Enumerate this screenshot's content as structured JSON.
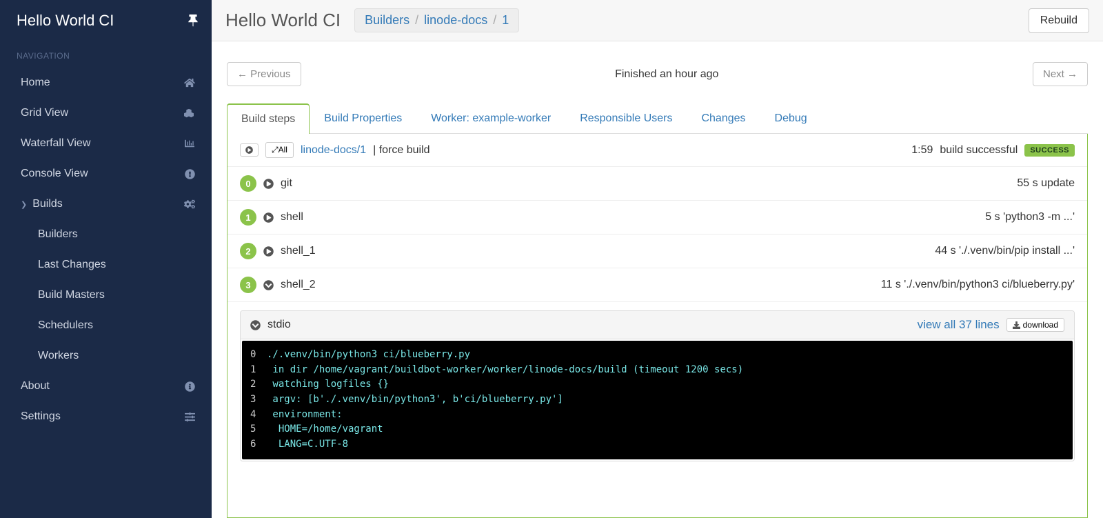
{
  "sidebar": {
    "title": "Hello World CI",
    "nav_label": "NAVIGATION",
    "items": [
      {
        "label": "Home"
      },
      {
        "label": "Grid View"
      },
      {
        "label": "Waterfall View"
      },
      {
        "label": "Console View"
      },
      {
        "label": "Builds"
      },
      {
        "label": "About"
      },
      {
        "label": "Settings"
      }
    ],
    "builds_sub": [
      {
        "label": "Builders"
      },
      {
        "label": "Last Changes"
      },
      {
        "label": "Build Masters"
      },
      {
        "label": "Schedulers"
      },
      {
        "label": "Workers"
      }
    ]
  },
  "header": {
    "title": "Hello World CI",
    "crumbs": [
      "Builders",
      "linode-docs",
      "1"
    ],
    "rebuild": "Rebuild"
  },
  "nav": {
    "prev": "← Previous",
    "next": "Next →",
    "finished": "Finished an hour ago"
  },
  "tabs": [
    "Build steps",
    "Build Properties",
    "Worker: example-worker",
    "Responsible Users",
    "Changes",
    "Debug"
  ],
  "summary": {
    "expand_all": "All",
    "link": "linode-docs/1",
    "desc": "| force build",
    "time": "1:59",
    "status_text": "build successful",
    "badge": "SUCCESS"
  },
  "steps": [
    {
      "n": "0",
      "name": "git",
      "right": "55 s update"
    },
    {
      "n": "1",
      "name": "shell",
      "right": "5 s 'python3 -m ...'"
    },
    {
      "n": "2",
      "name": "shell_1",
      "right": "44 s './.venv/bin/pip install ...'"
    },
    {
      "n": "3",
      "name": "shell_2",
      "right": "11 s './.venv/bin/python3 ci/blueberry.py'"
    }
  ],
  "stdio": {
    "title": "stdio",
    "view_all": "view all 37 lines",
    "download": "download",
    "lines": [
      {
        "n": "0",
        "t": "./.venv/bin/python3 ci/blueberry.py"
      },
      {
        "n": "1",
        "t": " in dir /home/vagrant/buildbot-worker/worker/linode-docs/build (timeout 1200 secs)"
      },
      {
        "n": "2",
        "t": " watching logfiles {}"
      },
      {
        "n": "3",
        "t": " argv: [b'./.venv/bin/python3', b'ci/blueberry.py']"
      },
      {
        "n": "4",
        "t": " environment:"
      },
      {
        "n": "5",
        "t": "  HOME=/home/vagrant"
      },
      {
        "n": "6",
        "t": "  LANG=C.UTF-8"
      }
    ]
  }
}
